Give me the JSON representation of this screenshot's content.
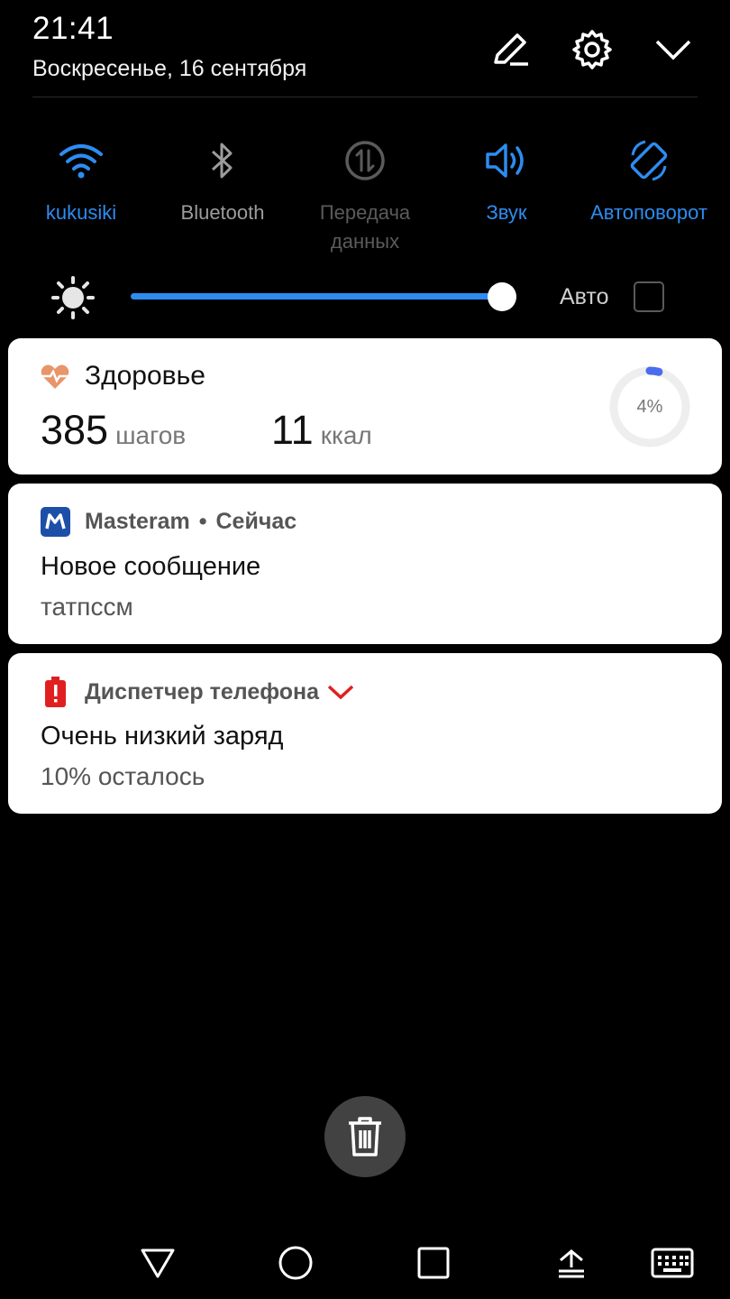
{
  "status": {
    "time": "21:41",
    "date": "Воскресенье, 16 сентября"
  },
  "header_icons": [
    "edit-icon",
    "settings-gear-icon",
    "chevron-down-icon"
  ],
  "tiles": [
    {
      "label": "kukusiki",
      "icon": "wifi-icon",
      "state": "on"
    },
    {
      "label": "Bluetooth",
      "icon": "bluetooth-icon",
      "state": "off"
    },
    {
      "label": "Передача данных",
      "icon": "mobile-data-icon",
      "state": "disabled"
    },
    {
      "label": "Звук",
      "icon": "sound-icon",
      "state": "on"
    },
    {
      "label": "Автоповорот",
      "icon": "auto-rotate-icon",
      "state": "on"
    }
  ],
  "brightness": {
    "level": 0.97,
    "auto_label": "Авто",
    "auto_checked": false
  },
  "health": {
    "app": "Здоровье",
    "steps_value": "385",
    "steps_unit": "шагов",
    "kcal_value": "11",
    "kcal_unit": "ккал",
    "progress_label": "4%",
    "progress": 0.04
  },
  "message": {
    "app": "Masteram",
    "separator": "•",
    "time": "Сейчас",
    "title": "Новое сообщение",
    "text": "татпссм"
  },
  "battery": {
    "app": "Диспетчер телефона",
    "title": "Очень низкий заряд",
    "text": "10% осталось"
  },
  "colors": {
    "accent": "#2d8cf0",
    "background": "#000000",
    "card": "#ffffff",
    "health_heart": "#e8956a",
    "battery_red": "#e02020",
    "masteram_blue": "#1e4fa8"
  }
}
